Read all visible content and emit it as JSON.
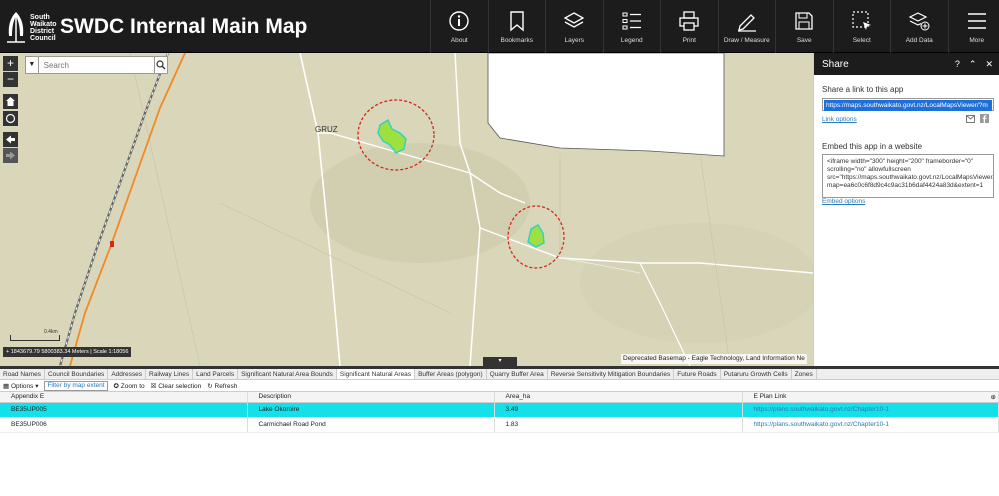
{
  "header": {
    "council_lines": [
      "South",
      "Waikato",
      "District",
      "Council"
    ],
    "title": "SWDC Internal Main Map",
    "tools": [
      {
        "label": "About",
        "icon": "info-icon"
      },
      {
        "label": "Bookmarks",
        "icon": "bookmark-icon"
      },
      {
        "label": "Layers",
        "icon": "layers-icon"
      },
      {
        "label": "Legend",
        "icon": "legend-icon"
      },
      {
        "label": "Print",
        "icon": "print-icon"
      },
      {
        "label": "Draw / Measure",
        "icon": "pencil-icon"
      },
      {
        "label": "Save",
        "icon": "save-icon"
      },
      {
        "label": "Select",
        "icon": "select-icon"
      },
      {
        "label": "Add Data",
        "icon": "add-data-icon"
      },
      {
        "label": "More",
        "icon": "hamburger-icon"
      }
    ]
  },
  "map": {
    "zoom_in": "+",
    "zoom_out": "−",
    "search_placeholder": "Search",
    "place_label": "GRUZ",
    "scale_label": "0.4km",
    "coords": "+ 1843679.79 5800383.34 Meters | Scale 1:18056",
    "attribution": "Deprecated Basemap - Eagle Technology, Land Information Ne",
    "collapse_glyph": "▾"
  },
  "share": {
    "title": "Share",
    "help": "?",
    "collapse": "⌃",
    "close": "✕",
    "link_label": "Share a link to this app",
    "link_url": "https://maps.southwaikato.govt.nz/LocalMapsViewer/?m",
    "link_options": "Link options",
    "embed_label": "Embed this app in a website",
    "embed_code": "<iframe width=\"300\" height=\"200\" frameborder=\"0\" scrolling=\"no\" allowfullscreen src=\"https://maps.southwaikato.govt.nz/LocalMapsViewer/?map=ea6c0c6f8d9c4c9ac31b6daf4424a83d&extent=1",
    "embed_options": "Embed options"
  },
  "table": {
    "tabs": [
      "Road Names",
      "Council Boundaries",
      "Addresses",
      "Railway Lines",
      "Land Parcels",
      "Significant Natural Area Bounds",
      "Significant Natural Areas",
      "Buffer Areas (polygon)",
      "Quarry Buffer Area",
      "Reverse Sensitivity Mitigation Boundaries",
      "Future Roads",
      "Putaruru Growth Cells",
      "Zones"
    ],
    "active_tab": 6,
    "toolbar": {
      "options": "Options",
      "filter": "Filter by map extent",
      "zoom": "Zoom to",
      "clear": "Clear selection",
      "refresh": "Refresh"
    },
    "columns": [
      "Appendix E",
      "Description",
      "Area_ha",
      "E Plan Link"
    ],
    "rows": [
      [
        "BE35UP005",
        "Lake Okoroire",
        "3.49",
        "https://plans.southwaikato.govt.nz/Chapter10-1"
      ],
      [
        "BE35UP006",
        "Carmichael Road Pond",
        "1.83",
        "https://plans.southwaikato.govt.nz/Chapter10-1"
      ]
    ],
    "selected_row": 0
  },
  "colors": {
    "header_bg": "#1c1c1c",
    "map_bg": "#d9d6ba",
    "selected_row": "#14e0ea",
    "link": "#2a7ab5",
    "buffer_ring": "#d9261c",
    "natural_area": "#9de03f"
  }
}
